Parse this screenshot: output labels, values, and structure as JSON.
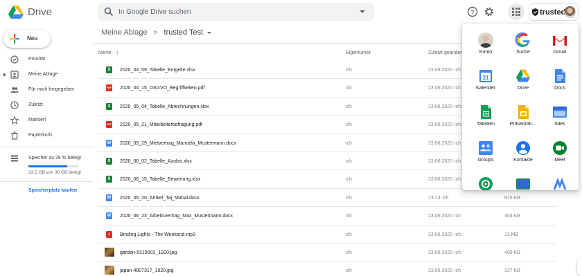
{
  "header": {
    "app_name": "Drive",
    "search_placeholder": "In Google Drive suchen",
    "brand": "trusted"
  },
  "sidebar": {
    "new_label": "Neu",
    "items": [
      {
        "label": "Priorität",
        "icon": "check-circle-icon"
      },
      {
        "label": "Meine Ablage",
        "icon": "my-drive-icon"
      },
      {
        "label": "Für mich freigegeben",
        "icon": "shared-people-icon"
      },
      {
        "label": "Zuletzt",
        "icon": "clock-icon"
      },
      {
        "label": "Markiert",
        "icon": "star-icon"
      },
      {
        "label": "Papierkorb",
        "icon": "trash-icon"
      },
      {
        "label": "Speicher zu 78 % belegt",
        "icon": "storage-icon"
      }
    ],
    "storage_used_text": "23,5 GB von 30 GB belegt",
    "storage_fraction": 0.78,
    "buy_storage": "Speicherplatz kaufen"
  },
  "breadcrumb": {
    "root": "Meine Ablage",
    "current": "trusted Test"
  },
  "table": {
    "col_name": "Name",
    "col_owner": "Eigentümer",
    "col_modified": "Zuletzt geändert",
    "rows": [
      {
        "type": "xlsx",
        "name": "2020_04_09_Tabelle_Entgelte.xlsx",
        "owner": "ich",
        "modified": "23.06.2020",
        "modified_by": "ich",
        "size": ""
      },
      {
        "type": "pdf",
        "name": "2020_04_15_DSGVO_Begriffkeiten.pdf",
        "owner": "ich",
        "modified": "23.06.2020",
        "modified_by": "ich",
        "size": ""
      },
      {
        "type": "xlsx",
        "name": "2020_05_04_Tabelle_Abrechnungen.xlsx",
        "owner": "ich",
        "modified": "23.06.2020",
        "modified_by": "ich",
        "size": ""
      },
      {
        "type": "pdf",
        "name": "2020_05_21_Mitarbeiterbefragung.pdf",
        "owner": "ich",
        "modified": "23.06.2020",
        "modified_by": "ich",
        "size": ""
      },
      {
        "type": "docx",
        "name": "2020_05_29_Mietvertrag_Manuela_Mustermann.docx",
        "owner": "ich",
        "modified": "23.06.2020",
        "modified_by": "ich",
        "size": ""
      },
      {
        "type": "xlsx",
        "name": "2020_06_02_Tabelle_Azubis.xlsx",
        "owner": "ich",
        "modified": "23.06.2020",
        "modified_by": "ich",
        "size": ""
      },
      {
        "type": "xlsx",
        "name": "2020_06_15_Tabelle_Bewertung.xlsx",
        "owner": "ich",
        "modified": "23.06.2020",
        "modified_by": "ich",
        "size": ""
      },
      {
        "type": "docx",
        "name": "2020_06_20_Artikel_Taj_Mahal.docx",
        "owner": "ich",
        "modified": "13:13",
        "modified_by": "ich",
        "size": "815 KB"
      },
      {
        "type": "docx",
        "name": "2020_06_23_Arbeitsvertrag_Max_Mustermann.docx",
        "owner": "ich",
        "modified": "23.06.2020",
        "modified_by": "ich",
        "size": "304 KB"
      },
      {
        "type": "mp3",
        "name": "Binding Lights - The Weekend.mp3",
        "owner": "ich",
        "modified": "23.06.2020",
        "modified_by": "ich",
        "size": "13 MB"
      },
      {
        "type": "jpg",
        "name": "garden-5315602_1920.jpg",
        "owner": "ich",
        "modified": "23.06.2020",
        "modified_by": "ich",
        "size": "469 KB"
      },
      {
        "type": "jpg",
        "name": "japan-4807317_1920.jpg",
        "owner": "ich",
        "modified": "23.06.2020",
        "modified_by": "ich",
        "size": "337 KB"
      }
    ]
  },
  "apps": [
    {
      "label": "Konto",
      "icon": "account-avatar-icon"
    },
    {
      "label": "Suche",
      "icon": "google-g-icon"
    },
    {
      "label": "Gmail",
      "icon": "gmail-icon"
    },
    {
      "label": "Kalender",
      "icon": "calendar-icon"
    },
    {
      "label": "Drive",
      "icon": "drive-icon"
    },
    {
      "label": "Docs",
      "icon": "docs-icon"
    },
    {
      "label": "Tabellen",
      "icon": "sheets-icon"
    },
    {
      "label": "Präsentati…",
      "icon": "slides-icon"
    },
    {
      "label": "Sites",
      "icon": "sites-icon"
    },
    {
      "label": "Groups",
      "icon": "groups-icon"
    },
    {
      "label": "Kontakte",
      "icon": "contacts-icon"
    },
    {
      "label": "Meet",
      "icon": "meet-icon"
    },
    {
      "label": "",
      "icon": "hangouts-icon"
    },
    {
      "label": "",
      "icon": "classroom-icon"
    },
    {
      "label": "",
      "icon": "photos-icon"
    }
  ],
  "colors": {
    "accent": "#1a73e8",
    "xlsx": "#188038",
    "pdf": "#d93025",
    "docx": "#4285f4",
    "mp3": "#d93025"
  }
}
